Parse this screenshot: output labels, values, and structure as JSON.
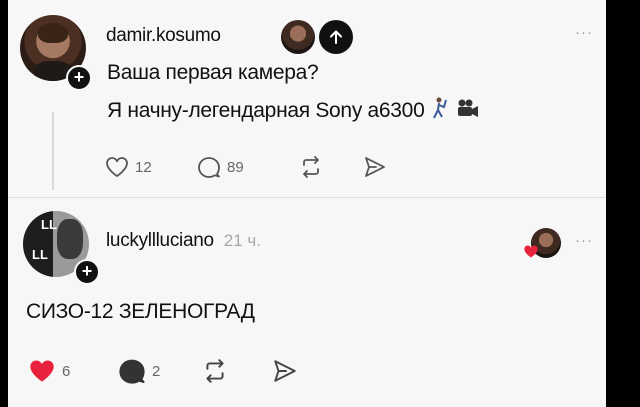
{
  "post": {
    "username": "damir.kosumo",
    "lines": [
      "Ваша первая камера?",
      "Я начну-легендарная Sony a6300"
    ],
    "like_count": "12",
    "comment_count": "89"
  },
  "reply": {
    "username": "luckyllluciano",
    "time": "21 ч.",
    "text": "СИЗО-12 ЗЕЛЕНОГРАД",
    "like_count": "6",
    "comment_count": "2",
    "avatar_letters": [
      "LL",
      "LL"
    ]
  },
  "more_label": "···",
  "colors": {
    "background": "#f7f7f7",
    "text": "#111111",
    "muted": "#a7a7a7",
    "like_active": "#e8223c"
  },
  "icons": [
    "heart-icon",
    "comment-icon",
    "repost-icon",
    "share-icon",
    "plus-icon",
    "arrow-up-icon",
    "video-camera-icon",
    "golf-emoji-icon"
  ]
}
